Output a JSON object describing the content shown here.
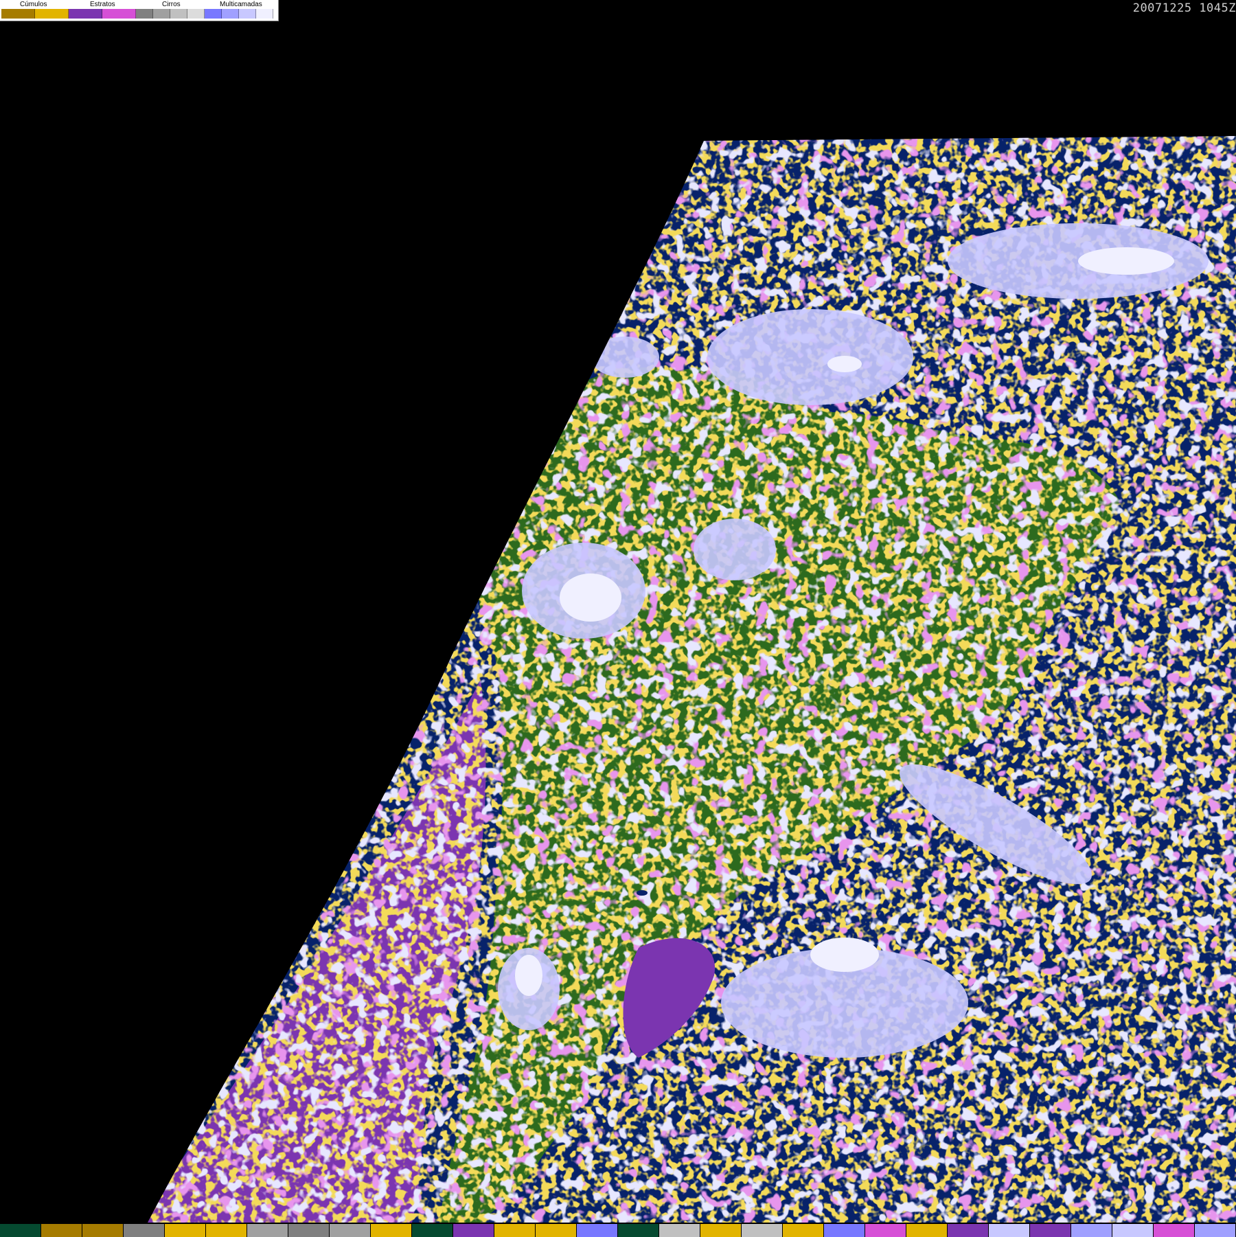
{
  "timestamp": "20071225 1045Z",
  "legend": {
    "groups": [
      {
        "label": "Cúmulos",
        "colors": [
          "#a67c00",
          "#e2b400"
        ]
      },
      {
        "label": "Estratos",
        "colors": [
          "#7b35b0",
          "#d650d6"
        ]
      },
      {
        "label": "Cirros",
        "colors": [
          "#808080",
          "#a0a0a0",
          "#c0c0c0",
          "#dcdcdc"
        ]
      },
      {
        "label": "Multicamadas",
        "colors": [
          "#7878ff",
          "#a0a0ff",
          "#c8c8ff",
          "#f0f0ff"
        ]
      }
    ]
  },
  "colors": {
    "ocean": "#07226a",
    "land": "#2d6a1e",
    "stratus_sea": "#7b35b0",
    "space": "#000000"
  },
  "bottom_bar": [
    "#054a30",
    "#a67c00",
    "#a67c00",
    "#808080",
    "#e2b400",
    "#e2b400",
    "#a0a0a0",
    "#808080",
    "#a0a0a0",
    "#e2b400",
    "#054a30",
    "#7b35b0",
    "#e2b400",
    "#e2b400",
    "#7878ff",
    "#054a30",
    "#c0c0c0",
    "#e2b400",
    "#c0c0c0",
    "#e2b400",
    "#7878ff",
    "#d650d6",
    "#e2b400",
    "#7b35b0",
    "#c8c8ff",
    "#7b35b0",
    "#a0a0ff",
    "#c8c8ff",
    "#d650d6",
    "#a0a0ff"
  ]
}
